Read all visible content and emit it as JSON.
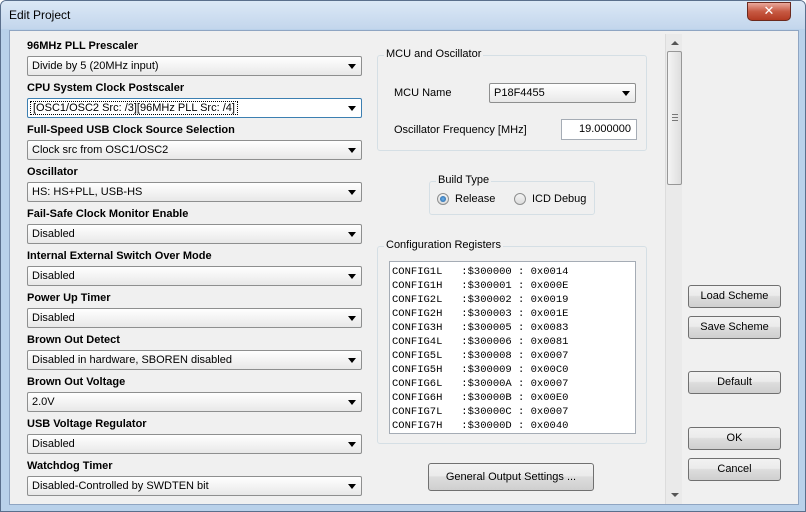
{
  "window": {
    "title": "Edit Project",
    "close_glyph": "✕"
  },
  "settings": [
    {
      "label": "96MHz PLL Prescaler",
      "value": "Divide by 5 (20MHz input)"
    },
    {
      "label": "CPU System Clock Postscaler",
      "value": "[OSC1/OSC2 Src: /3][96MHz PLL Src: /4]"
    },
    {
      "label": "Full-Speed USB Clock Source Selection",
      "value": "Clock src from OSC1/OSC2"
    },
    {
      "label": "Oscillator",
      "value": "HS: HS+PLL, USB-HS"
    },
    {
      "label": "Fail-Safe Clock Monitor Enable",
      "value": "Disabled"
    },
    {
      "label": "Internal External Switch Over Mode",
      "value": "Disabled"
    },
    {
      "label": "Power Up Timer",
      "value": "Disabled"
    },
    {
      "label": "Brown Out Detect",
      "value": "Disabled in hardware, SBOREN disabled"
    },
    {
      "label": "Brown Out Voltage",
      "value": "2.0V"
    },
    {
      "label": "USB Voltage Regulator",
      "value": "Disabled"
    },
    {
      "label": "Watchdog Timer",
      "value": "Disabled-Controlled by SWDTEN bit"
    }
  ],
  "mcu": {
    "group_title": "MCU and Oscillator",
    "name_label": "MCU Name",
    "name_value": "P18F4455",
    "freq_label": "Oscillator Frequency [MHz]",
    "freq_value": "19.000000"
  },
  "build_type": {
    "group_title": "Build Type",
    "options": [
      {
        "label": "Release",
        "checked": true
      },
      {
        "label": "ICD Debug",
        "checked": false
      }
    ]
  },
  "config_registers": {
    "group_title": "Configuration Registers",
    "lines": [
      "CONFIG1L   :$300000 : 0x0014",
      "CONFIG1H   :$300001 : 0x000E",
      "CONFIG2L   :$300002 : 0x0019",
      "CONFIG2H   :$300003 : 0x001E",
      "CONFIG3H   :$300005 : 0x0083",
      "CONFIG4L   :$300006 : 0x0081",
      "CONFIG5L   :$300008 : 0x0007",
      "CONFIG5H   :$300009 : 0x00C0",
      "CONFIG6L   :$30000A : 0x0007",
      "CONFIG6H   :$30000B : 0x00E0",
      "CONFIG7L   :$30000C : 0x0007",
      "CONFIG7H   :$30000D : 0x0040"
    ]
  },
  "buttons": {
    "general_output": "General Output Settings ...",
    "load_scheme": "Load Scheme",
    "save_scheme": "Save Scheme",
    "default": "Default",
    "ok": "OK",
    "cancel": "Cancel"
  }
}
